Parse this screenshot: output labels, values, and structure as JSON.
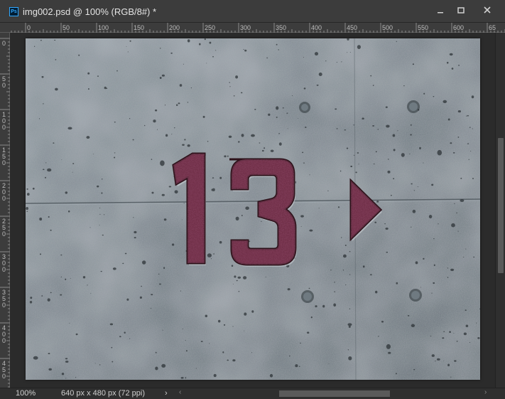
{
  "window": {
    "title": "img002.psd @ 100% (RGB/8#) *",
    "app_icon_label": "Ps",
    "controls": [
      "minimize-icon",
      "maximize-icon",
      "close-icon"
    ]
  },
  "ruler": {
    "top_labels": [
      "0",
      "50",
      "100",
      "150",
      "200",
      "250",
      "300",
      "350",
      "400",
      "450",
      "500",
      "550",
      "600",
      "65"
    ],
    "left_labels": [
      "0",
      "5\n0",
      "1\n0\n0",
      "1\n5\n0",
      "2\n0\n0",
      "2\n5\n0",
      "3\n0\n0",
      "3\n5\n0",
      "4\n0\n0",
      "4\n5\n0"
    ]
  },
  "image": {
    "number_text": "13",
    "colors": {
      "concrete": "#7f8a92",
      "paint": "#6b2a3f"
    }
  },
  "status": {
    "zoom": "100%",
    "doc_info": "640 px x 480 px (72 ppi)",
    "arrow": "›"
  }
}
